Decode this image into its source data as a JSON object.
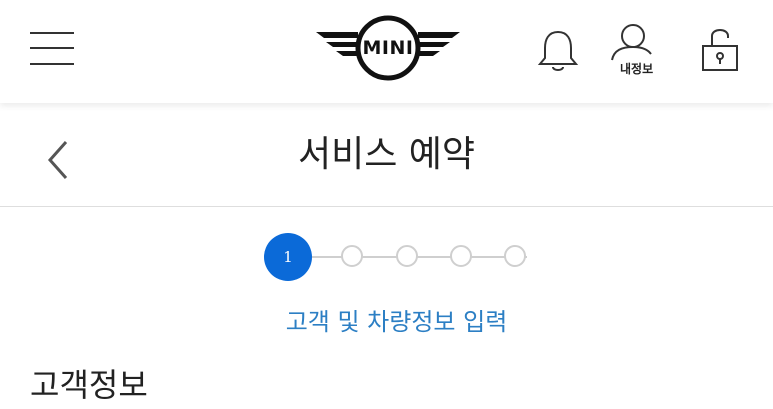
{
  "header": {
    "brand": "MINI",
    "menu_icon": "hamburger-menu-icon",
    "notification_icon": "bell-icon",
    "profile_icon": "user-icon",
    "profile_label": "내정보",
    "lock_icon": "unlock-icon"
  },
  "page": {
    "back_icon": "chevron-left-icon",
    "title": "서비스 예약"
  },
  "stepper": {
    "current_step": "1",
    "total_steps": 5,
    "active_color": "#0b6ad8",
    "current_label": "고객 및 차량정보 입력"
  },
  "section": {
    "title": "고객정보"
  }
}
